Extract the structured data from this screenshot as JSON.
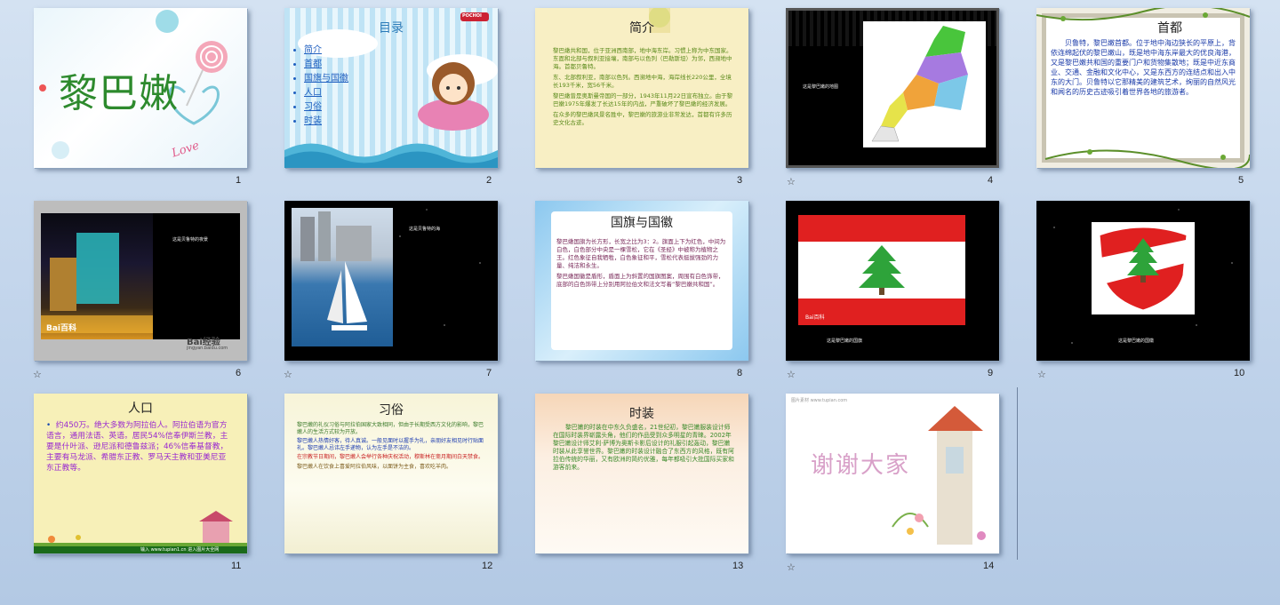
{
  "slides": [
    {
      "num": "1",
      "title": "黎巴嫩",
      "deco": "Love"
    },
    {
      "num": "2",
      "title": "目录",
      "items": [
        "简介",
        "首都",
        "国旗与国徽",
        "人口",
        "习俗",
        "时装"
      ],
      "logo": "POCHOI"
    },
    {
      "num": "3",
      "title": "简介",
      "paras": [
        "黎巴嫩共和国，位于亚洲西南部，地中海东岸。习惯上称为中东国家。东面和北部与叙利亚接壤，南部与以色列（巴勒斯坦）为邻，西濒地中海。首都贝鲁特。",
        "东、北部叙利亚，南部以色列。西濒地中海，海岸线长220公里，全境长193千米，宽56千米。",
        "黎巴嫩曾是奥斯曼帝国的一部分，1943年11月22日宣布独立。由于黎巴嫩1975年爆发了长达15年的内战，严重破坏了黎巴嫩的经济发展。",
        "在众多的黎巴嫩风景名胜中，黎巴嫩的旅游业非常发达，首都有许多历史文化古迹。"
      ]
    },
    {
      "num": "4",
      "caption": "这是黎巴嫩的地图",
      "star": "☆"
    },
    {
      "num": "5",
      "title": "首都",
      "text": "贝鲁特，黎巴嫩首都。位于地中海边狭长的平原上，背依连绵起伏的黎巴嫩山，既是地中海东岸最大的优良海港，又是黎巴嫩共和国的重要门户和货物集散地；既是中近东商业、交通、金融和文化中心，又是东西方的连结点和出入中东的大门。贝鲁特以它那精美的建筑艺术，绚丽的自然风光和闻名的历史古迹吸引着世界各地的旅游者。"
    },
    {
      "num": "6",
      "caption": "这是贝鲁特的夜景",
      "watermark": "Bai百科",
      "watermark2": "Bai经验",
      "watermark3": "jingyan.baidu.com",
      "star": "☆"
    },
    {
      "num": "7",
      "caption": "这是贝鲁特的海",
      "star": "☆"
    },
    {
      "num": "8",
      "title": "国旗与国徽",
      "paras": [
        "黎巴嫩国旗为长方形，长宽之比为3：2。旗面上下为红色，中间为白色，白色部分中央是一棵雪松，它在《圣经》中被称为植物之王。红色象征自我牺牲，白色象征和平，雪松代表挺拔强劲的力量、纯洁和永生。",
        "黎巴嫩国徽是盾形，盾面上为斜置的国旗图案，周围有白色饰带，底部的白色饰带上分别用阿拉伯文和法文写着“黎巴嫩共和国”。"
      ]
    },
    {
      "num": "9",
      "caption": "这是黎巴嫩的国旗",
      "watermark": "Bai百科",
      "star": "☆"
    },
    {
      "num": "10",
      "caption": "这是黎巴嫩的国徽",
      "star": "☆"
    },
    {
      "num": "11",
      "title": "人口",
      "text": "约450万。绝大多数为阿拉伯人。阿拉伯语为官方语言，通用法语、英语。居民54%信奉伊斯兰教，主要是什叶派、逊尼派和德鲁兹派；46%信奉基督教，主要有马龙派、希腊东正教、罗马天主教和亚美尼亚东正教等。",
      "footer": "输入 www.tupian1.cn 进入图片大全网"
    },
    {
      "num": "12",
      "title": "习俗",
      "paras": [
        "黎巴嫩的礼仪习俗与阿拉伯国家大致相同，但由于长期受西方文化的影响，黎巴嫩人的生活方式较为开放。",
        "黎巴嫩人热情好客，待人真诚。一般见面时以握手为礼，亲朋好友相见时行贴面礼。黎巴嫩人忌讳左手递物，认为左手是不洁的。",
        "在宗教节日期间，黎巴嫩人会举行各种庆祝活动，穆斯林在斋月期间白天禁食。",
        "黎巴嫩人在饮食上喜爱阿拉伯风味，以面饼为主食，喜欢吃羊肉。"
      ]
    },
    {
      "num": "13",
      "title": "时装",
      "text": "黎巴嫩的时装在中东久负盛名，21世纪初，黎巴嫩服装设计师在国际时装界崭露头角，他们的作品受到众多明星的青睐。2002年黎巴嫩设计师艾利·萨博为奥斯卡影后设计的礼服引起轰动，黎巴嫩时装从此享誉世界。黎巴嫩的时装设计融合了东西方的风格，既有阿拉伯传统的华丽，又有欧洲的简约优雅，每年都吸引大批国际买家和游客前来。"
    },
    {
      "num": "14",
      "title": "谢谢大家",
      "watermark": "图片素材 www.tupian.com",
      "star": "☆"
    }
  ]
}
